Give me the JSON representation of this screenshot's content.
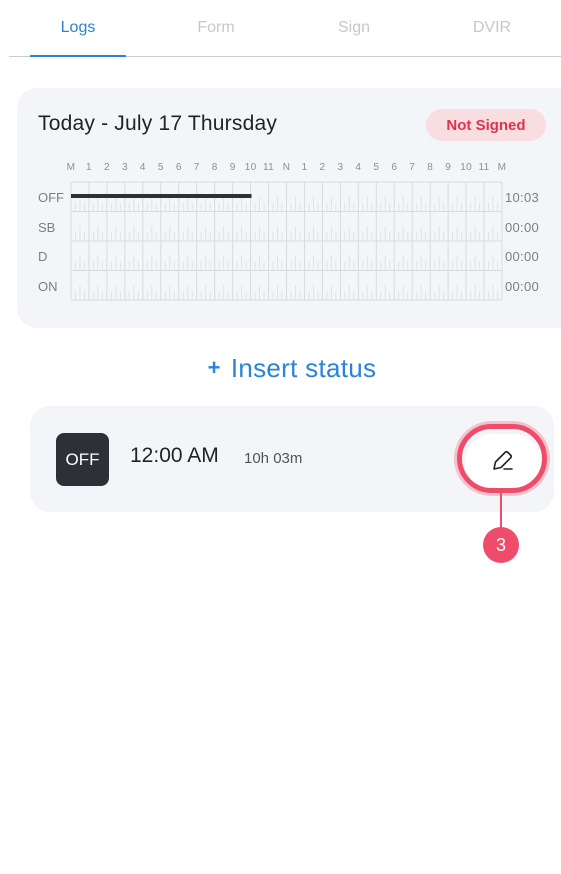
{
  "tabs": [
    {
      "label": "Logs",
      "active": true
    },
    {
      "label": "Form",
      "active": false
    },
    {
      "label": "Sign",
      "active": false
    },
    {
      "label": "DVIR",
      "active": false
    }
  ],
  "day_card": {
    "title": "Today - July 17 Thursday",
    "badge": "Not Signed",
    "hour_labels": [
      "M",
      "1",
      "2",
      "3",
      "4",
      "5",
      "6",
      "7",
      "8",
      "9",
      "10",
      "11",
      "N",
      "1",
      "2",
      "3",
      "4",
      "5",
      "6",
      "7",
      "8",
      "9",
      "10",
      "11",
      "M"
    ],
    "rows": [
      {
        "label": "OFF",
        "total": "10:03"
      },
      {
        "label": "SB",
        "total": "00:00"
      },
      {
        "label": "D",
        "total": "00:00"
      },
      {
        "label": "ON",
        "total": "00:00"
      }
    ],
    "duty_segments": [
      {
        "status": "OFF",
        "start_hour": 0,
        "end_hour": 10.05
      }
    ]
  },
  "insert_status": {
    "plus": "+",
    "label": "Insert status"
  },
  "log_entry": {
    "status": "OFF",
    "time": "12:00 AM",
    "duration": "10h 03m"
  },
  "annotation": {
    "number": "3"
  },
  "colors": {
    "accent": "#2a83d8",
    "badge_text": "#e0334f",
    "badge_bg": "#f8dde1",
    "highlight": "#ef4b6a",
    "status_off_bg": "#2d3137"
  }
}
